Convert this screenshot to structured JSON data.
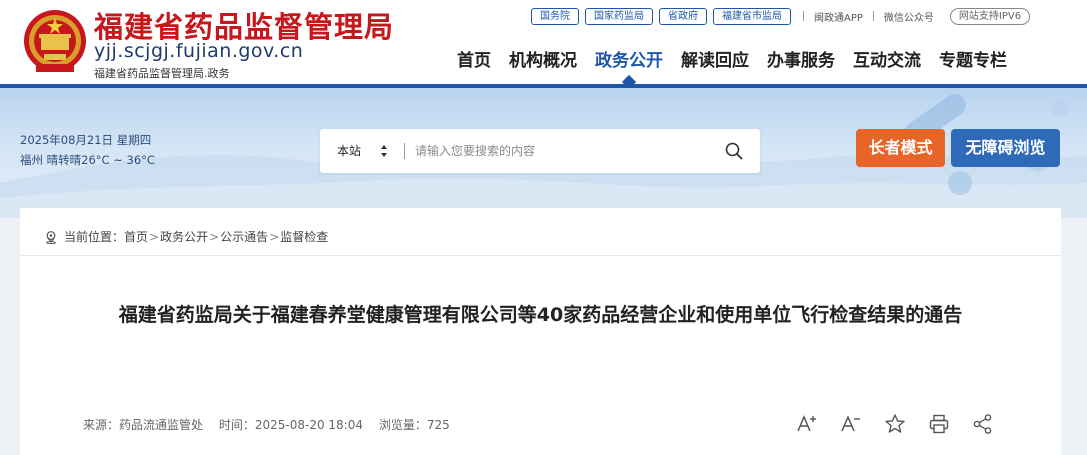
{
  "header": {
    "title": "福建省药品监督管理局",
    "domain": "yjj.scjgj.fujian.gov.cn",
    "subtitle": "福建省药品监督管理局.政务",
    "emblem_icon": "national-emblem-icon",
    "toplinks": [
      "国务院",
      "国家药监局",
      "省政府",
      "福建省市监局"
    ],
    "app_link": "闽政通APP",
    "wechat_link": "微信公众号",
    "ipv6_badge": "网站支持IPV6"
  },
  "nav": {
    "items": [
      "首页",
      "机构概况",
      "政务公开",
      "解读回应",
      "办事服务",
      "互动交流",
      "专题专栏"
    ],
    "active_index": 2
  },
  "banner": {
    "date": "2025年08月21日 星期四",
    "weather": "福州 晴转晴26°C ~ 36°C",
    "search": {
      "scope": "本站",
      "placeholder": "请输入您要搜索的内容",
      "icon": "search-icon"
    },
    "elder_mode": "长者模式",
    "accessibility": "无障碍浏览"
  },
  "breadcrumb": {
    "prefix": "当前位置：",
    "items": [
      "首页",
      "政务公开",
      "公示通告",
      "监督检查"
    ],
    "separator": ">",
    "icon": "location-pin-icon"
  },
  "article": {
    "title": "福建省药监局关于福建春养堂健康管理有限公司等40家药品经营企业和使用单位飞行检查结果的通告",
    "source": "来源：药品流通监管处",
    "time": "时间：2025-08-20 18:04",
    "views": "浏览量：725",
    "tools": [
      "font-increase-icon",
      "font-decrease-icon",
      "star-icon",
      "print-icon",
      "share-icon"
    ]
  },
  "colors": {
    "brand_red": "#c8161d",
    "brand_blue": "#1f56a8",
    "elder_orange": "#e8652a",
    "access_blue": "#2e6ab8"
  }
}
